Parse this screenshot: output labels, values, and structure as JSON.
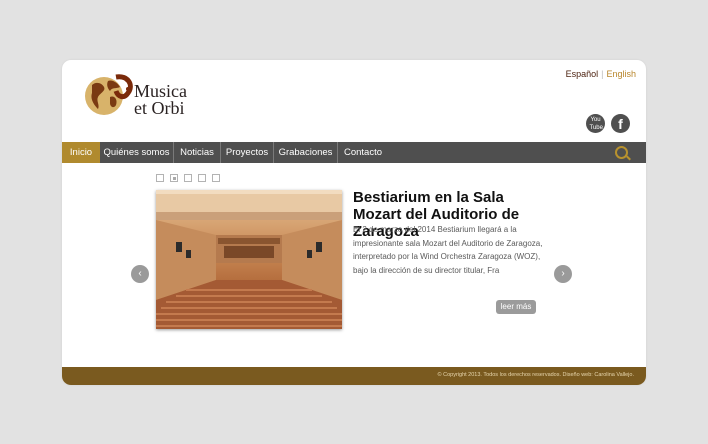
{
  "brand": {
    "line1": "Musica",
    "line2": "et Orbi"
  },
  "languages": {
    "spanish": "Español",
    "separator": "|",
    "english": "English"
  },
  "social": {
    "youtube_label": "You Tube",
    "facebook_label": "f"
  },
  "nav": {
    "items": [
      {
        "label": "Inicio"
      },
      {
        "label": "Quiénes somos"
      },
      {
        "label": "Noticias"
      },
      {
        "label": "Proyectos"
      },
      {
        "label": "Grabaciones"
      },
      {
        "label": "Contacto"
      }
    ],
    "active_index": 0
  },
  "slider": {
    "dot_count": 5,
    "active_dot": 1,
    "prev_label": "‹",
    "next_label": "›"
  },
  "article": {
    "title": "Bestiarium en la Sala Mozart del Auditorio de Zaragoza",
    "body": "El 2 de marzo del 2014 Bestiarium llegará a la impresionante sala Mozart del Auditorio de Zaragoza, interpretado por la Wind Orchestra Zaragoza (WOZ), bajo la dirección de su director titular, Fra",
    "read_more": "leer más"
  },
  "footer": {
    "copyright": "© Copyright 2013. Todos los derechos reservados. Diseño web: Carolina Vallejo."
  },
  "colors": {
    "nav": "#4f4f4f",
    "accent": "#b08a2e",
    "footer": "#7a5a1f",
    "background": "#e2e2e2"
  }
}
